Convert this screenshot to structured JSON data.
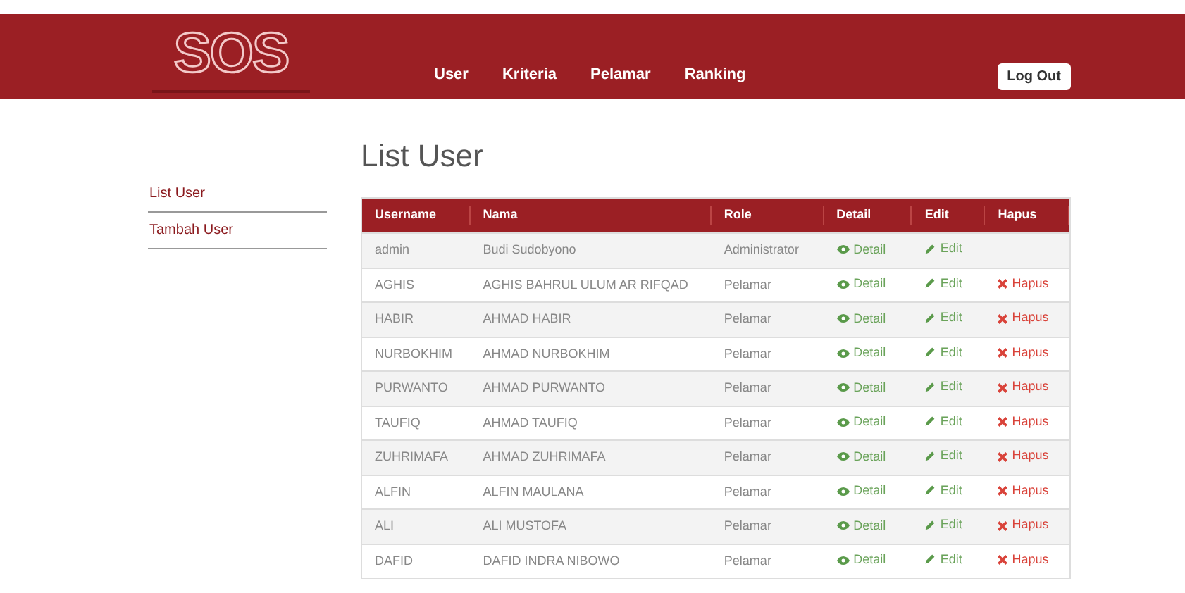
{
  "header": {
    "logo": "SOS",
    "nav": [
      {
        "label": "User"
      },
      {
        "label": "Kriteria"
      },
      {
        "label": "Pelamar"
      },
      {
        "label": "Ranking"
      }
    ],
    "logout": "Log Out"
  },
  "sidebar": {
    "items": [
      {
        "label": "List User"
      },
      {
        "label": "Tambah User"
      }
    ]
  },
  "title": "List User",
  "table": {
    "columns": [
      "Username",
      "Nama",
      "Role",
      "Detail",
      "Edit",
      "Hapus"
    ],
    "rows": [
      {
        "username": "admin",
        "name": "Budi Sudobyono",
        "role": "Administrator",
        "detail": "Detail",
        "edit": "Edit"
      },
      {
        "username": "AGHIS",
        "name": "AGHIS BAHRUL ULUM AR RIFQAD",
        "role": "Pelamar",
        "detail": "Detail",
        "edit": "Edit",
        "delete": "Hapus"
      },
      {
        "username": "HABIR",
        "name": "AHMAD HABIR",
        "role": "Pelamar",
        "detail": "Detail",
        "edit": "Edit",
        "delete": "Hapus"
      },
      {
        "username": "NURBOKHIM",
        "name": "AHMAD NURBOKHIM",
        "role": "Pelamar",
        "detail": "Detail",
        "edit": "Edit",
        "delete": "Hapus"
      },
      {
        "username": "PURWANTO",
        "name": "AHMAD PURWANTO",
        "role": "Pelamar",
        "detail": "Detail",
        "edit": "Edit",
        "delete": "Hapus"
      },
      {
        "username": "TAUFIQ",
        "name": "AHMAD TAUFIQ",
        "role": "Pelamar",
        "detail": "Detail",
        "edit": "Edit",
        "delete": "Hapus"
      },
      {
        "username": "ZUHRIMAFA",
        "name": "AHMAD ZUHRIMAFA",
        "role": "Pelamar",
        "detail": "Detail",
        "edit": "Edit",
        "delete": "Hapus"
      },
      {
        "username": "ALFIN",
        "name": "ALFIN MAULANA",
        "role": "Pelamar",
        "detail": "Detail",
        "edit": "Edit",
        "delete": "Hapus"
      },
      {
        "username": "ALI",
        "name": "ALI MUSTOFA",
        "role": "Pelamar",
        "detail": "Detail",
        "edit": "Edit",
        "delete": "Hapus"
      },
      {
        "username": "DAFID",
        "name": "DAFID INDRA NIBOWO",
        "role": "Pelamar",
        "detail": "Detail",
        "edit": "Edit",
        "delete": "Hapus"
      }
    ]
  }
}
